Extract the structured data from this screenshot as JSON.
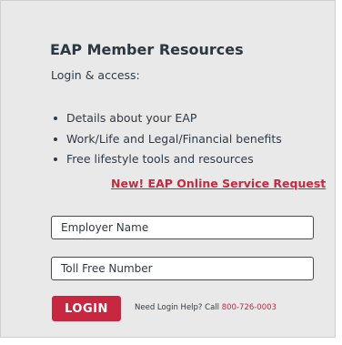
{
  "panel": {
    "title": "EAP Member Resources",
    "subtitle": "Login & access:",
    "benefits": [
      "Details about your EAP",
      "Work/Life and Legal/Financial benefits",
      "Free lifestyle tools and resources"
    ],
    "online_request_link": "New! EAP Online Service Request"
  },
  "form": {
    "employer_placeholder": "Employer Name",
    "tollfree_placeholder": "Toll Free Number",
    "login_label": "LOGIN",
    "help_label": "Need Login Help? Call",
    "help_phone": "800-726-0003"
  },
  "colors": {
    "accent": "#c8283f",
    "panel_background": "#e9e9e9",
    "text": "#2f3a45"
  }
}
